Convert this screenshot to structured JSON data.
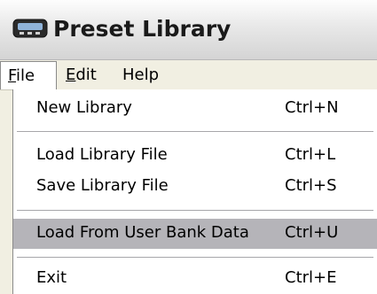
{
  "window": {
    "title": "Preset Library",
    "icon": "app-icon"
  },
  "menubar": {
    "items": [
      {
        "label": "File",
        "accel": "F",
        "rest": "ile",
        "active": true
      },
      {
        "label": "Edit",
        "accel": "E",
        "rest": "dit",
        "active": false
      },
      {
        "label": "Help",
        "accel": "",
        "rest": "Help",
        "active": false
      }
    ]
  },
  "file_menu": {
    "items": [
      {
        "label": "New Library",
        "shortcut": "Ctrl+N"
      },
      {
        "label": "Load Library File",
        "shortcut": "Ctrl+L"
      },
      {
        "label": "Save Library File",
        "shortcut": "Ctrl+S"
      },
      {
        "label": "Load From User Bank Data",
        "shortcut": "Ctrl+U",
        "highlighted": true
      },
      {
        "label": "Exit",
        "shortcut": "Ctrl+E"
      }
    ]
  },
  "colors": {
    "highlight": "#b5b4b9",
    "menubar_bg": "#f1efe2"
  }
}
